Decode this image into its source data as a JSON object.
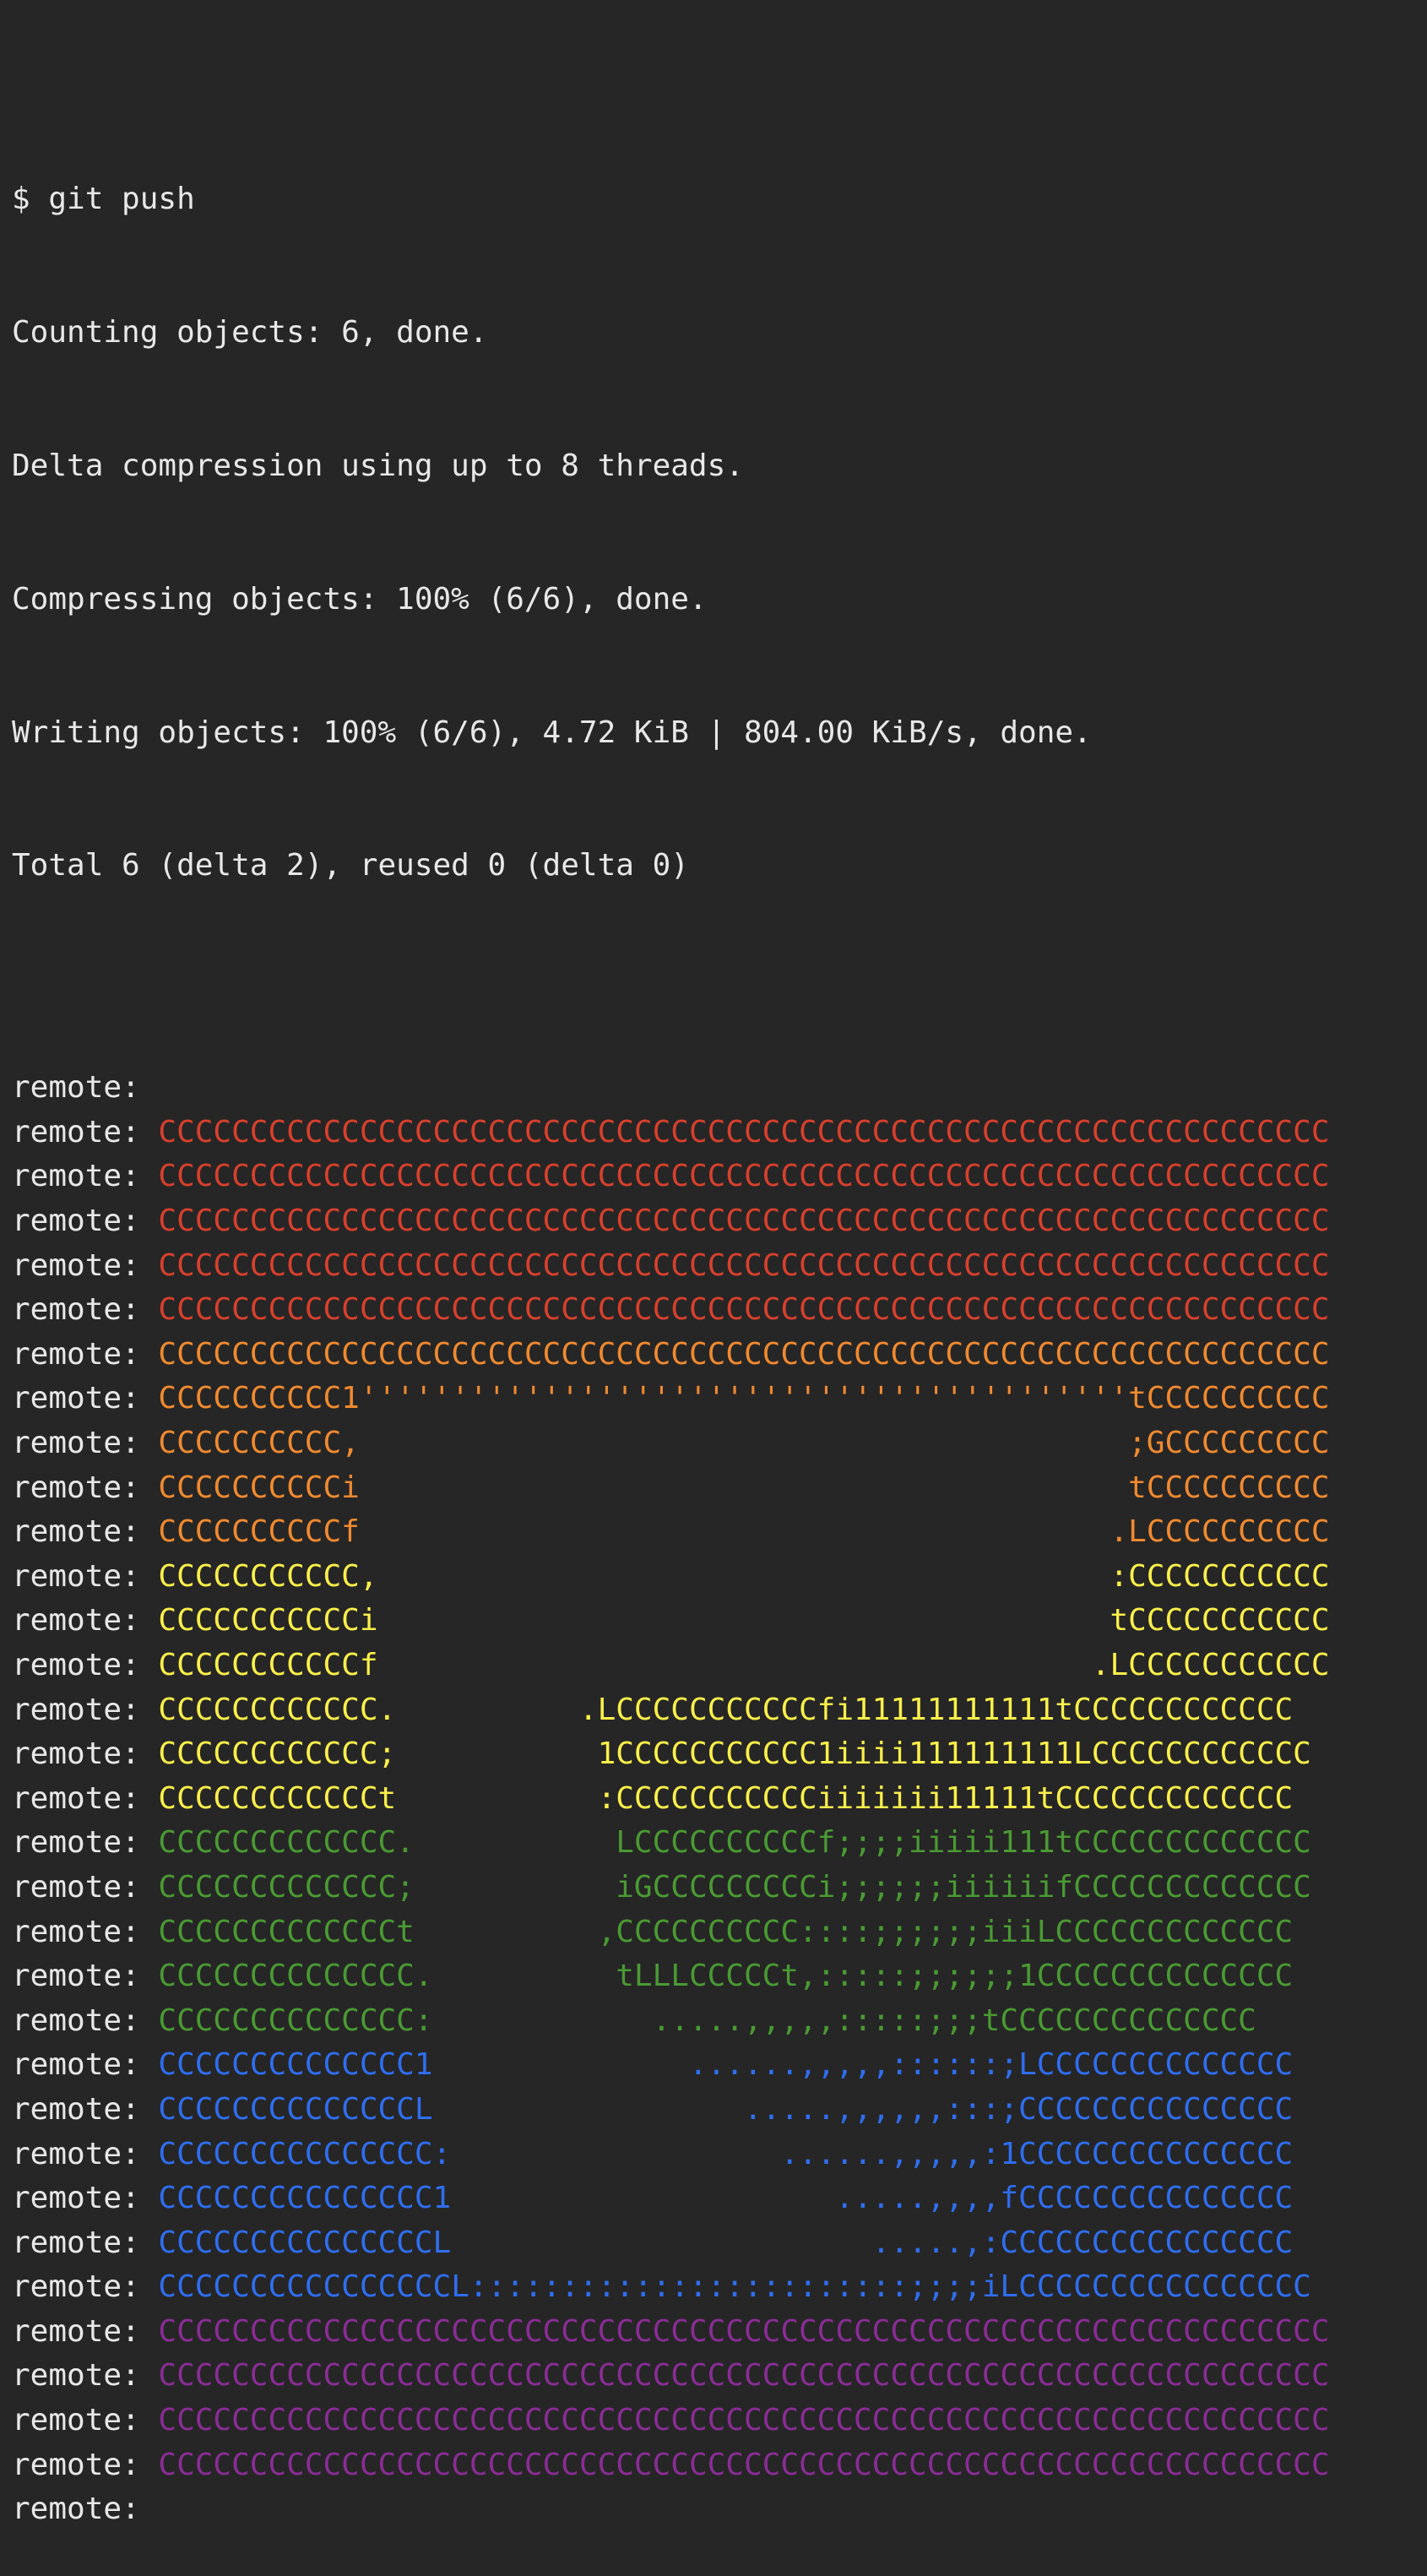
{
  "colors": {
    "background": "#262626",
    "text": "#e8e8e8",
    "red": "#d8402d",
    "orange": "#f08a30",
    "yellow": "#fbf04a",
    "green": "#4a9a33",
    "blue": "#2f6ef0",
    "purple": "#8a2d96"
  },
  "terminal": {
    "header": [
      "$ git push",
      "Counting objects: 6, done.",
      "Delta compression using up to 8 threads.",
      "Compressing objects: 100% (6/6), done.",
      "Writing objects: 100% (6/6), 4.72 KiB | 804.00 KiB/s, done.",
      "Total 6 (delta 2), reused 0 (delta 0)"
    ],
    "prefix": "remote:",
    "remote_lines": [
      {
        "text": "",
        "color": "text"
      },
      {
        "text": "CCCCCCCCCCCCCCCCCCCCCCCCCCCCCCCCCCCCCCCCCCCCCCCCCCCCCCCCCCCCCCCC",
        "color": "red"
      },
      {
        "text": "CCCCCCCCCCCCCCCCCCCCCCCCCCCCCCCCCCCCCCCCCCCCCCCCCCCCCCCCCCCCCCCC",
        "color": "red"
      },
      {
        "text": "CCCCCCCCCCCCCCCCCCCCCCCCCCCCCCCCCCCCCCCCCCCCCCCCCCCCCCCCCCCCCCCC",
        "color": "red"
      },
      {
        "text": "CCCCCCCCCCCCCCCCCCCCCCCCCCCCCCCCCCCCCCCCCCCCCCCCCCCCCCCCCCCCCCCC",
        "color": "red"
      },
      {
        "text": "CCCCCCCCCCCCCCCCCCCCCCCCCCCCCCCCCCCCCCCCCCCCCCCCCCCCCCCCCCCCCCCC",
        "color": "red"
      },
      {
        "text": "CCCCCCCCCCCCCCCCCCCCCCCCCCCCCCCCCCCCCCCCCCCCCCCCCCCCCCCCCCCCCCCC",
        "color": "orange"
      },
      {
        "text": "CCCCCCCCCC1''''''''''''''''''''''''''''''''''''''''''tCCCCCCCCCC",
        "color": "orange"
      },
      {
        "text": "CCCCCCCCCC,                                          ;GCCCCCCCCC",
        "color": "orange"
      },
      {
        "text": "CCCCCCCCCCi                                          tCCCCCCCCCC",
        "color": "orange"
      },
      {
        "text": "CCCCCCCCCCf                                         .LCCCCCCCCCC",
        "color": "orange"
      },
      {
        "text": "CCCCCCCCCCC,                                        :CCCCCCCCCCC",
        "color": "yellow"
      },
      {
        "text": "CCCCCCCCCCCi                                        tCCCCCCCCCCC",
        "color": "yellow"
      },
      {
        "text": "CCCCCCCCCCCf                                       .LCCCCCCCCCCC",
        "color": "yellow"
      },
      {
        "text": "CCCCCCCCCCCC.          .LCCCCCCCCCCCfi11111111111tCCCCCCCCCCCC",
        "color": "yellow"
      },
      {
        "text": "CCCCCCCCCCCC;           1CCCCCCCCCCC1iiii111111111LCCCCCCCCCCCC",
        "color": "yellow"
      },
      {
        "text": "CCCCCCCCCCCCt           :CCCCCCCCCCCiiiiiii11111tCCCCCCCCCCCCC",
        "color": "yellow"
      },
      {
        "text": "CCCCCCCCCCCCC.           LCCCCCCCCCCf;;;;iiiii111tCCCCCCCCCCCCC",
        "color": "green"
      },
      {
        "text": "CCCCCCCCCCCCC;           iGCCCCCCCCCi;;;;;;iiiiiifCCCCCCCCCCCCC",
        "color": "green"
      },
      {
        "text": "CCCCCCCCCCCCCt          ,CCCCCCCCCC::::;;;;;;iiiLCCCCCCCCCCCCC",
        "color": "green"
      },
      {
        "text": "CCCCCCCCCCCCCC.          tLLLCCCCCt,:::::;;;;;;1CCCCCCCCCCCCCC",
        "color": "green"
      },
      {
        "text": "CCCCCCCCCCCCCC:            .....,,,,,:::::;;;tCCCCCCCCCCCCCC",
        "color": "green"
      },
      {
        "text": "CCCCCCCCCCCCCC1              ......,,,,,::::::;LCCCCCCCCCCCCCC",
        "color": "blue"
      },
      {
        "text": "CCCCCCCCCCCCCCL                 .....,,,,,,:::;CCCCCCCCCCCCCCC",
        "color": "blue"
      },
      {
        "text": "CCCCCCCCCCCCCCC:                  ......,,,,,:1CCCCCCCCCCCCCCC",
        "color": "blue"
      },
      {
        "text": "CCCCCCCCCCCCCCC1                     .....,,,,fCCCCCCCCCCCCCCC",
        "color": "blue"
      },
      {
        "text": "CCCCCCCCCCCCCCCL                       .....,:CCCCCCCCCCCCCCCC",
        "color": "blue"
      },
      {
        "text": "CCCCCCCCCCCCCCCCL::::::::::::::::::::::::;;;;iLCCCCCCCCCCCCCCCC",
        "color": "blue"
      },
      {
        "text": "CCCCCCCCCCCCCCCCCCCCCCCCCCCCCCCCCCCCCCCCCCCCCCCCCCCCCCCCCCCCCCCC",
        "color": "purple"
      },
      {
        "text": "CCCCCCCCCCCCCCCCCCCCCCCCCCCCCCCCCCCCCCCCCCCCCCCCCCCCCCCCCCCCCCCC",
        "color": "purple"
      },
      {
        "text": "CCCCCCCCCCCCCCCCCCCCCCCCCCCCCCCCCCCCCCCCCCCCCCCCCCCCCCCCCCCCCCCC",
        "color": "purple"
      },
      {
        "text": "CCCCCCCCCCCCCCCCCCCCCCCCCCCCCCCCCCCCCCCCCCCCCCCCCCCCCCCCCCCCCCCC",
        "color": "purple"
      },
      {
        "text": "",
        "color": "text"
      }
    ]
  }
}
